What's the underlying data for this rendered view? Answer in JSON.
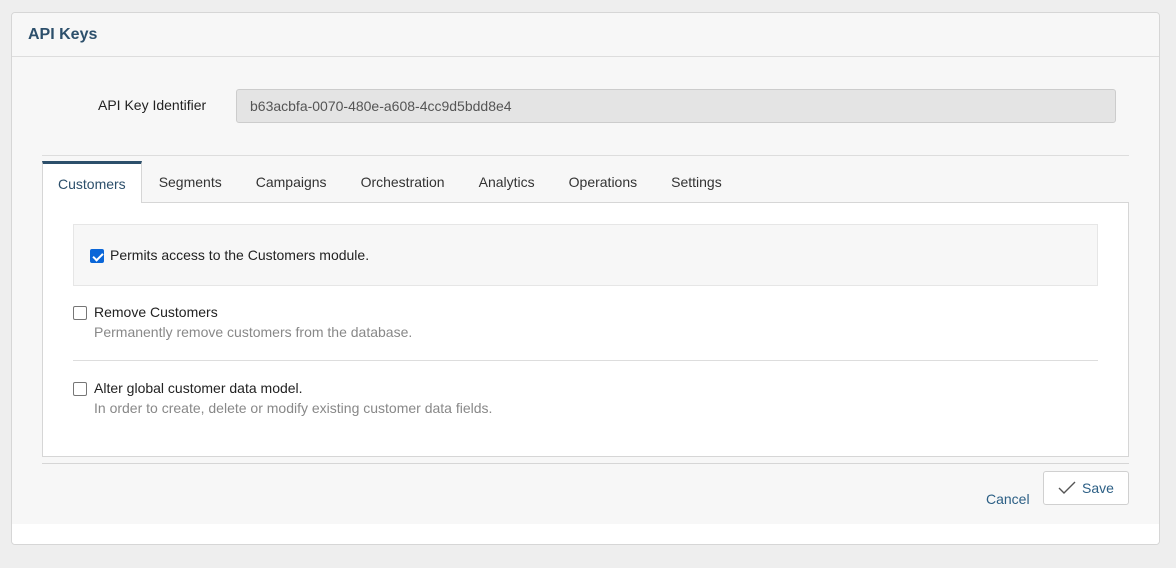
{
  "panel": {
    "title": "API Keys"
  },
  "api_key": {
    "label": "API Key Identifier",
    "value": "b63acbfa-0070-480e-a608-4cc9d5bdd8e4"
  },
  "tabs": [
    {
      "label": "Customers",
      "active": true
    },
    {
      "label": "Segments"
    },
    {
      "label": "Campaigns"
    },
    {
      "label": "Orchestration"
    },
    {
      "label": "Analytics"
    },
    {
      "label": "Operations"
    },
    {
      "label": "Settings"
    }
  ],
  "module_access": {
    "label": "Permits access to the Customers module.",
    "checked": true
  },
  "permissions": [
    {
      "title": "Remove Customers",
      "description": "Permanently remove customers from the database.",
      "checked": false
    },
    {
      "title": "Alter global customer data model.",
      "description": "In order to create, delete or modify existing customer data fields.",
      "checked": false
    }
  ],
  "footer": {
    "cancel_label": "Cancel",
    "save_label": "Save",
    "save_icon": "checkmark-icon"
  },
  "colors": {
    "accent": "#2c4f6b",
    "link": "#2c5f85",
    "checkbox_checked": "#0a66d8"
  }
}
